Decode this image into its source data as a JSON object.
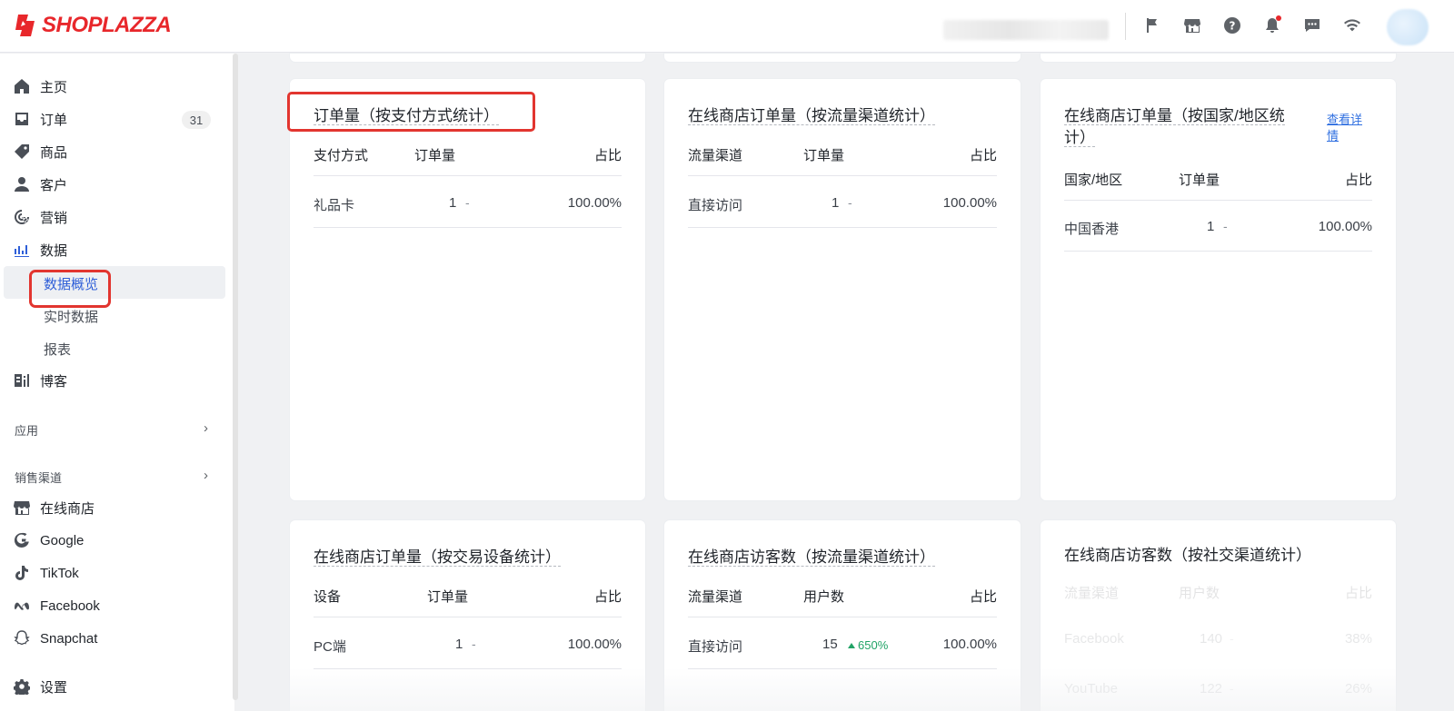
{
  "brand": {
    "name": "SHOPLAZZA",
    "color": "#e8272b"
  },
  "topbar": {
    "icons": [
      "flag-icon",
      "store-icon",
      "help-icon",
      "bell-icon",
      "chat-icon",
      "wifi-icon"
    ]
  },
  "sidebar": {
    "items": [
      {
        "label": "主页",
        "icon": "home-icon"
      },
      {
        "label": "订单",
        "icon": "inbox-icon",
        "badge": "31"
      },
      {
        "label": "商品",
        "icon": "tag-icon"
      },
      {
        "label": "客户",
        "icon": "person-icon"
      },
      {
        "label": "营销",
        "icon": "target-icon"
      },
      {
        "label": "数据",
        "icon": "bar-chart-icon"
      }
    ],
    "data_sub": [
      {
        "label": "数据概览",
        "active": true
      },
      {
        "label": "实时数据"
      },
      {
        "label": "报表"
      }
    ],
    "blog": {
      "label": "博客",
      "icon": "blog-icon"
    },
    "apps_section": "应用",
    "sales_section": "销售渠道",
    "channels": [
      {
        "label": "在线商店",
        "icon": "store-icon"
      },
      {
        "label": "Google",
        "icon": "google-icon"
      },
      {
        "label": "TikTok",
        "icon": "tiktok-icon"
      },
      {
        "label": "Facebook",
        "icon": "meta-icon"
      },
      {
        "label": "Snapchat",
        "icon": "snapchat-icon"
      }
    ],
    "settings": {
      "label": "设置",
      "icon": "gear-icon"
    }
  },
  "cards": {
    "payment": {
      "title": "订单量（按支付方式统计）",
      "headers": [
        "支付方式",
        "订单量",
        "占比"
      ],
      "rows": [
        {
          "name": "礼品卡",
          "count": "1",
          "change": "-",
          "pct": "100.00%"
        }
      ]
    },
    "traffic_orders": {
      "title": "在线商店订单量（按流量渠道统计）",
      "headers": [
        "流量渠道",
        "订单量",
        "占比"
      ],
      "rows": [
        {
          "name": "直接访问",
          "count": "1",
          "change": "-",
          "pct": "100.00%"
        }
      ]
    },
    "country_orders": {
      "title_line1": "在线商店订单量（按国家/地区统",
      "title_line2": "计）",
      "link_line1": "查看详",
      "link_line2": "情",
      "headers": [
        "国家/地区",
        "订单量",
        "占比"
      ],
      "rows": [
        {
          "name": "中国香港",
          "count": "1",
          "change": "-",
          "pct": "100.00%"
        }
      ]
    },
    "device_orders": {
      "title": "在线商店订单量（按交易设备统计）",
      "headers": [
        "设备",
        "订单量",
        "占比"
      ],
      "rows": [
        {
          "name": "PC端",
          "count": "1",
          "change": "-",
          "pct": "100.00%"
        }
      ]
    },
    "traffic_visitors": {
      "title": "在线商店访客数（按流量渠道统计）",
      "headers": [
        "流量渠道",
        "用户数",
        "占比"
      ],
      "rows": [
        {
          "name": "直接访问",
          "count": "15",
          "change": "650%",
          "pct": "100.00%"
        }
      ]
    },
    "social_visitors": {
      "title": "在线商店访客数（按社交渠道统计）",
      "headers": [
        "流量渠道",
        "用户数",
        "占比"
      ],
      "rows": [
        {
          "name": "Facebook",
          "count": "140",
          "change": "-",
          "pct": "38%"
        },
        {
          "name": "YouTube",
          "count": "122",
          "change": "-",
          "pct": "26%"
        }
      ]
    }
  },
  "colors": {
    "highlight": "#e2352f",
    "accent": "#2f5fd8",
    "trend_up": "#21a366"
  }
}
